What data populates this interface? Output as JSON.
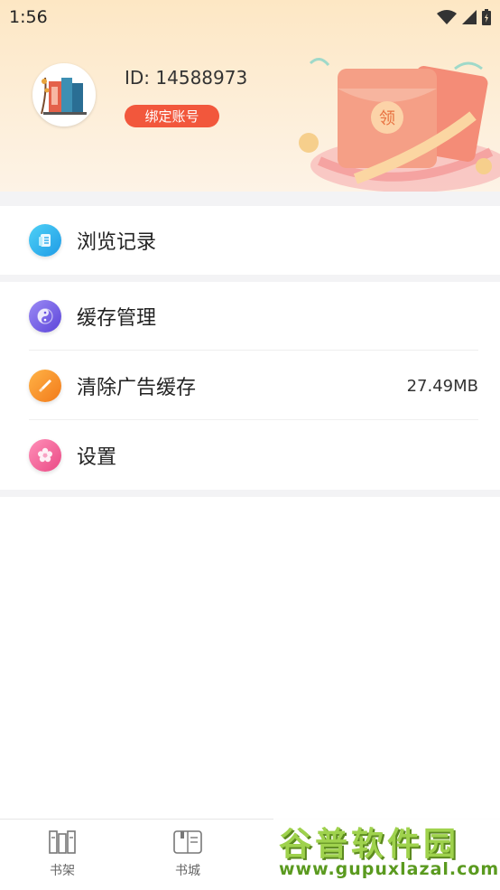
{
  "status_bar": {
    "time": "1:56"
  },
  "profile": {
    "id_text": "ID: 14588973",
    "bind_label": "绑定账号",
    "banner_badge": "领"
  },
  "menu": {
    "history": {
      "label": "浏览记录",
      "icon": "document-icon",
      "color": "#2ab7ef"
    },
    "cache": {
      "label": "缓存管理",
      "icon": "yin-yang-icon",
      "color": "#7a63e8"
    },
    "clear_ad": {
      "label": "清除广告缓存",
      "value": "27.49MB",
      "icon": "brush-icon",
      "color": "#f7962a"
    },
    "settings": {
      "label": "设置",
      "icon": "flower-icon",
      "color": "#f25b93"
    }
  },
  "nav": {
    "shelf": "书架",
    "store": "书城"
  },
  "watermark": {
    "title": "谷普软件园",
    "url": "www.gupuxlazal.com"
  },
  "colors": {
    "accent": "#f2573c",
    "header_bg": "#fde7c4"
  }
}
